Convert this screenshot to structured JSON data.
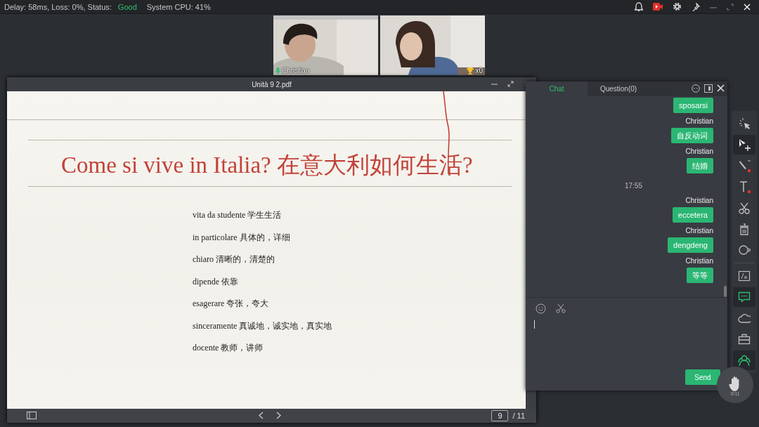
{
  "status_bar": {
    "network": "Delay: 58ms, Loss: 0%, Status:",
    "status": "Good",
    "cpu": "System CPU: 41%"
  },
  "videos": [
    {
      "kind": "name",
      "label": "Christian"
    },
    {
      "kind": "trophy",
      "label": "x0"
    }
  ],
  "document": {
    "title": "Unità 9 2.pdf",
    "heading": "Come si vive in Italia? 在意大利如何生活?",
    "lines": [
      "vita da studente 学生生活",
      "in particolare 具体的，详细",
      "chiaro 清晰的，清楚的",
      "dipende  依靠",
      "esagerare 夸张，夸大",
      "sinceramente 真诚地，诚实地，真实地",
      "docente 教师，讲师"
    ],
    "page": "9",
    "total": "/ 11"
  },
  "chat": {
    "tabs": [
      {
        "label": "Chat",
        "selected": true
      },
      {
        "label": "Question(0)",
        "selected": false
      }
    ],
    "messages": [
      {
        "kind": "bubble",
        "text": "sposarsi"
      },
      {
        "kind": "sender",
        "text": "Christian"
      },
      {
        "kind": "bubble",
        "text": "自反动词"
      },
      {
        "kind": "sender",
        "text": "Christian"
      },
      {
        "kind": "bubble",
        "text": "结婚"
      },
      {
        "kind": "time",
        "text": "17:55"
      },
      {
        "kind": "sender",
        "text": "Christian"
      },
      {
        "kind": "bubble",
        "text": "eccetera"
      },
      {
        "kind": "sender",
        "text": "Christian"
      },
      {
        "kind": "bubble",
        "text": "dengdeng"
      },
      {
        "kind": "sender",
        "text": "Christian"
      },
      {
        "kind": "bubble",
        "text": "等等"
      }
    ],
    "send": "Send"
  },
  "tool_groups": [
    [
      {
        "kind": "laser",
        "selected": false
      },
      {
        "kind": "move",
        "selected": true
      },
      {
        "kind": "pen",
        "selected": false
      },
      {
        "kind": "text",
        "selected": false
      },
      {
        "kind": "scissors",
        "selected": false
      },
      {
        "kind": "trash",
        "selected": false
      },
      {
        "kind": "shape",
        "selected": false
      }
    ],
    [
      {
        "kind": "board",
        "selected": false
      },
      {
        "kind": "chat",
        "selected": true
      },
      {
        "kind": "cloud",
        "selected": false
      },
      {
        "kind": "toolbox",
        "selected": false
      },
      {
        "kind": "people",
        "selected": true
      }
    ]
  ],
  "hand": {
    "count": "0/11"
  }
}
